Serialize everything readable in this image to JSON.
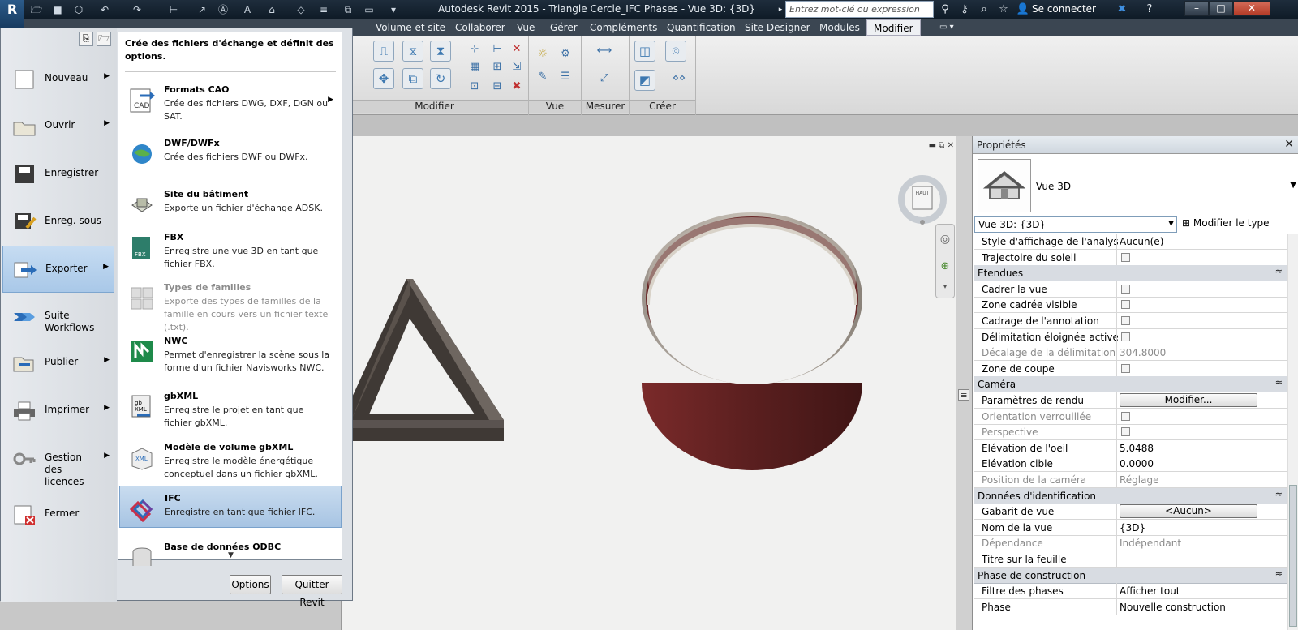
{
  "titlebar": {
    "title": "Autodesk Revit 2015 -     Triangle Cercle_IFC Phases - Vue 3D: {3D}",
    "search_placeholder": "Entrez mot-clé ou expression",
    "signin": "Se connecter"
  },
  "app_button": "R",
  "ribbon": {
    "tabs": [
      "Volume et site",
      "Collaborer",
      "Vue",
      "Gérer",
      "Compléments",
      "Quantification",
      "Site Designer",
      "Modules",
      "Modifier"
    ],
    "panels": [
      "Modifier",
      "Vue",
      "Mesurer",
      "Créer"
    ]
  },
  "app_menu": {
    "nav": [
      {
        "label": "Nouveau",
        "icon": "new-file-icon"
      },
      {
        "label": "Ouvrir",
        "icon": "open-folder-icon"
      },
      {
        "label": "Enregistrer",
        "icon": "save-icon"
      },
      {
        "label": "Enreg. sous",
        "icon": "save-as-icon"
      },
      {
        "label": "Exporter",
        "icon": "export-icon"
      },
      {
        "label": "Suite Workflows",
        "icon": "workflow-icon"
      },
      {
        "label": "Publier",
        "icon": "publish-icon"
      },
      {
        "label": "Imprimer",
        "icon": "printer-icon"
      },
      {
        "label": "Gestion des licences",
        "icon": "license-key-icon"
      },
      {
        "label": "Fermer",
        "icon": "close-file-icon"
      }
    ],
    "submenu_header": "Crée des fichiers d'échange et définit des options.",
    "items": [
      {
        "title": "Formats CAO",
        "desc": "Crée des fichiers DWG, DXF, DGN ou SAT."
      },
      {
        "title": "DWF/DWFx",
        "desc": "Crée des fichiers DWF ou DWFx."
      },
      {
        "title": "Site du bâtiment",
        "desc": "Exporte un fichier d'échange ADSK."
      },
      {
        "title": "FBX",
        "desc": "Enregistre une vue 3D en tant que fichier FBX."
      },
      {
        "title": "Types de familles",
        "desc": "Exporte des types de familles de la famille en cours vers un fichier texte (.txt)."
      },
      {
        "title": "NWC",
        "desc": "Permet d'enregistrer la scène sous la forme d'un fichier Navisworks NWC."
      },
      {
        "title": "gbXML",
        "desc": "Enregistre le projet en tant que fichier gbXML."
      },
      {
        "title": "Modèle de volume gbXML",
        "desc": "Enregistre le modèle énergétique conceptuel dans un fichier gbXML."
      },
      {
        "title": "IFC",
        "desc": "Enregistre en tant que fichier IFC."
      },
      {
        "title": "Base de données ODBC",
        "desc": ""
      }
    ],
    "options_btn": "Options",
    "quit_btn": "Quitter Revit"
  },
  "properties": {
    "title": "Propriétés",
    "type_name": "Vue 3D",
    "type_selector": "Vue 3D: {3D}",
    "edit_type": "Modifier le type",
    "rows": [
      {
        "k": "row",
        "name": "Style d'affichage de l'analyse...",
        "value": "Aucun(e)"
      },
      {
        "k": "row",
        "name": "Trajectoire du soleil",
        "check": true
      },
      {
        "k": "section",
        "name": "Etendues"
      },
      {
        "k": "row",
        "name": "Cadrer la vue",
        "check": true
      },
      {
        "k": "row",
        "name": "Zone cadrée visible",
        "check": true
      },
      {
        "k": "row",
        "name": "Cadrage de l'annotation",
        "check": true
      },
      {
        "k": "row",
        "name": "Délimitation éloignée active",
        "check": true
      },
      {
        "k": "row",
        "name": "Décalage de la délimitation ...",
        "value": "304.8000",
        "dim": true
      },
      {
        "k": "row",
        "name": "Zone de coupe",
        "check": true
      },
      {
        "k": "section",
        "name": "Caméra"
      },
      {
        "k": "row",
        "name": "Paramètres de rendu",
        "button": "Modifier..."
      },
      {
        "k": "row",
        "name": "Orientation verrouillée",
        "check": true,
        "dim": true
      },
      {
        "k": "row",
        "name": "Perspective",
        "check": true,
        "dim": true
      },
      {
        "k": "row",
        "name": "Elévation de l'oeil",
        "value": "5.0488"
      },
      {
        "k": "row",
        "name": "Elévation cible",
        "value": "0.0000"
      },
      {
        "k": "row",
        "name": "Position de la caméra",
        "value": "Réglage",
        "dim": true
      },
      {
        "k": "section",
        "name": "Données d'identification"
      },
      {
        "k": "row",
        "name": "Gabarit de vue",
        "button": "<Aucun>"
      },
      {
        "k": "row",
        "name": "Nom de la vue",
        "value": "{3D}"
      },
      {
        "k": "row",
        "name": "Dépendance",
        "value": "Indépendant",
        "dim": true
      },
      {
        "k": "row",
        "name": "Titre sur la feuille",
        "value": ""
      },
      {
        "k": "section",
        "name": "Phase de construction"
      },
      {
        "k": "row",
        "name": "Filtre des phases",
        "value": "Afficher tout"
      },
      {
        "k": "row",
        "name": "Phase",
        "value": "Nouvelle construction"
      }
    ]
  },
  "viewcube_label": "HAUT",
  "colors": {
    "accent": "#3d78b0",
    "selection": "#b4cde8",
    "titlebar": "#1a2734",
    "ring_outer": "#6a2a2a",
    "triangle": "#4a4340"
  }
}
